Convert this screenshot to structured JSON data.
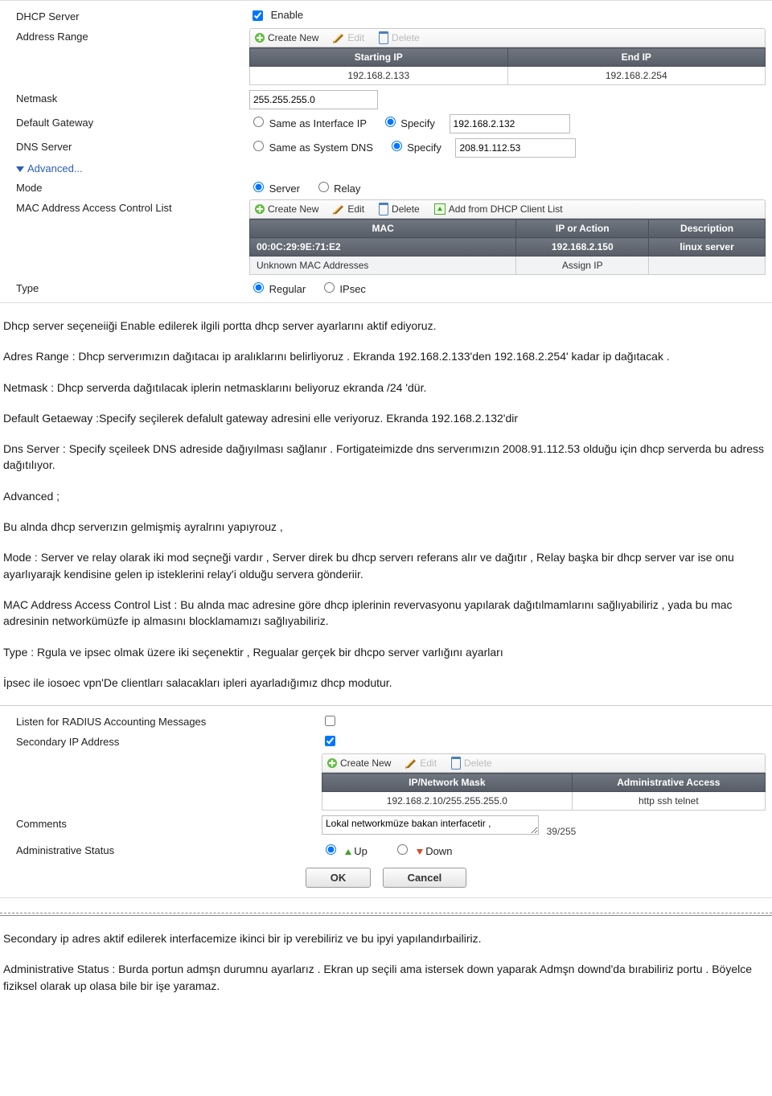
{
  "s1": {
    "dhcp_server_label": "DHCP Server",
    "enable_label": "Enable",
    "addr_range_label": "Address Range",
    "toolbar": {
      "create": "Create New",
      "edit": "Edit",
      "delete": "Delete"
    },
    "addr_table": {
      "h1": "Starting IP",
      "h2": "End IP",
      "r1c1": "192.168.2.133",
      "r1c2": "192.168.2.254"
    },
    "netmask_label": "Netmask",
    "netmask_value": "255.255.255.0",
    "gw_label": "Default Gateway",
    "gw_opt1": "Same as Interface IP",
    "gw_opt2": "Specify",
    "gw_value": "192.168.2.132",
    "dns_label": "DNS Server",
    "dns_opt1": "Same as System DNS",
    "dns_opt2": "Specify",
    "dns_value": "208.91.112.53",
    "advanced_label": "Advanced...",
    "mode_label": "Mode",
    "mode_opt1": "Server",
    "mode_opt2": "Relay",
    "macacl_label": "MAC Address Access Control List",
    "macacl_tb": {
      "create": "Create New",
      "edit": "Edit",
      "delete": "Delete",
      "import": "Add from DHCP Client List"
    },
    "macacl_table": {
      "h1": "MAC",
      "h2": "IP or Action",
      "h3": "Description",
      "r1c1": "00:0C:29:9E:71:E2",
      "r1c2": "192.168.2.150",
      "r1c3": "linux server",
      "r2c1": "Unknown MAC Addresses",
      "r2c2": "Assign IP",
      "r2c3": ""
    },
    "type_label": "Type",
    "type_opt1": "Regular",
    "type_opt2": "IPsec"
  },
  "para": {
    "p1": "Dhcp server seçeneiiği Enable edilerek ilgili portta dhcp server ayarlarını  aktif ediyoruz.",
    "p2": "Adres Range : Dhcp serverımızın dağıtacaı ip aralıklarını belirliyoruz .  Ekranda  192.168.2.133'den 192.168.2.254' kadar ip dağıtacak .",
    "p3": "Netmask : Dhcp serverda dağıtılacak iplerin netmasklarını beliyoruz ekranda /24 'dür.",
    "p4": "Default Getaeway :Specify seçilerek defalult gateway  adresini elle  veriyoruz. Ekranda 192.168.2.132'dir",
    "p5": "Dns Server : Specify sçeileek DNS adreside dağıyılması sağlanır . Fortigateimizde dns serverımızın 2008.91.112.53 olduğu için dhcp serverda bu adress dağıtılıyor.",
    "p6": "Advanced ;",
    "p7": "Bu alnda dhcp serverızın gelmişmiş ayralrını yapıyrouz ,",
    "p8": "Mode : Server ve relay olarak iki mod seçneği vardır , Server direk bu dhcp serverı referans alır ve dağıtır , Relay başka bir dhcp server var ise onu ayarlıyarajk kendisine gelen ip isteklerini  relay'i olduğu servera gönderiir.",
    "p9": "MAC Address Access Control List : Bu alnda  mac adresine göre   dhcp iplerinin revervasyonu yapılarak dağıtılmamlarını sağlıyabiliriz , yada bu mac adresinin networkümüzfe ip almasını blocklamamızı sağlıyabiliriz.",
    "p10": "Type :  Rgula ve ipsec olmak üzere iki seçenektir , Regualar  gerçek bir dhcpo server  varlığını ayarları",
    "p11": "İpsec ile iosoec vpn'De clientları salacakları ipleri ayarladığımız dhcp modutur."
  },
  "s2": {
    "radius_label": "Listen for RADIUS Accounting Messages",
    "secip_label": "Secondary IP Address",
    "toolbar": {
      "create": "Create New",
      "edit": "Edit",
      "delete": "Delete"
    },
    "table": {
      "h1": "IP/Network Mask",
      "h2": "Administrative Access",
      "r1c1": "192.168.2.10/255.255.255.0",
      "r1c2": "http ssh telnet"
    },
    "comments_label": "Comments",
    "comments_value": "Lokal networkmüze bakan interfacetir ,",
    "comments_count": "39/255",
    "adm_label": "Administrative Status",
    "adm_opt1": "Up",
    "adm_opt2": "Down",
    "ok": "OK",
    "cancel": "Cancel"
  },
  "para2": {
    "p1": "Secondary ip adres aktif edilerek  interfacemize ikinci bir ip verebiliriz  ve bu ipyi yapılandırbailiriz.",
    "p2": "Administrative Status : Burda portun admşn durumnu ayarlarız . Ekran up seçili ama istersek down yaparak Admşn downd'da bırabiliriz portu . Böyelce fiziksel olarak up olasa bile bir işe yaramaz."
  }
}
